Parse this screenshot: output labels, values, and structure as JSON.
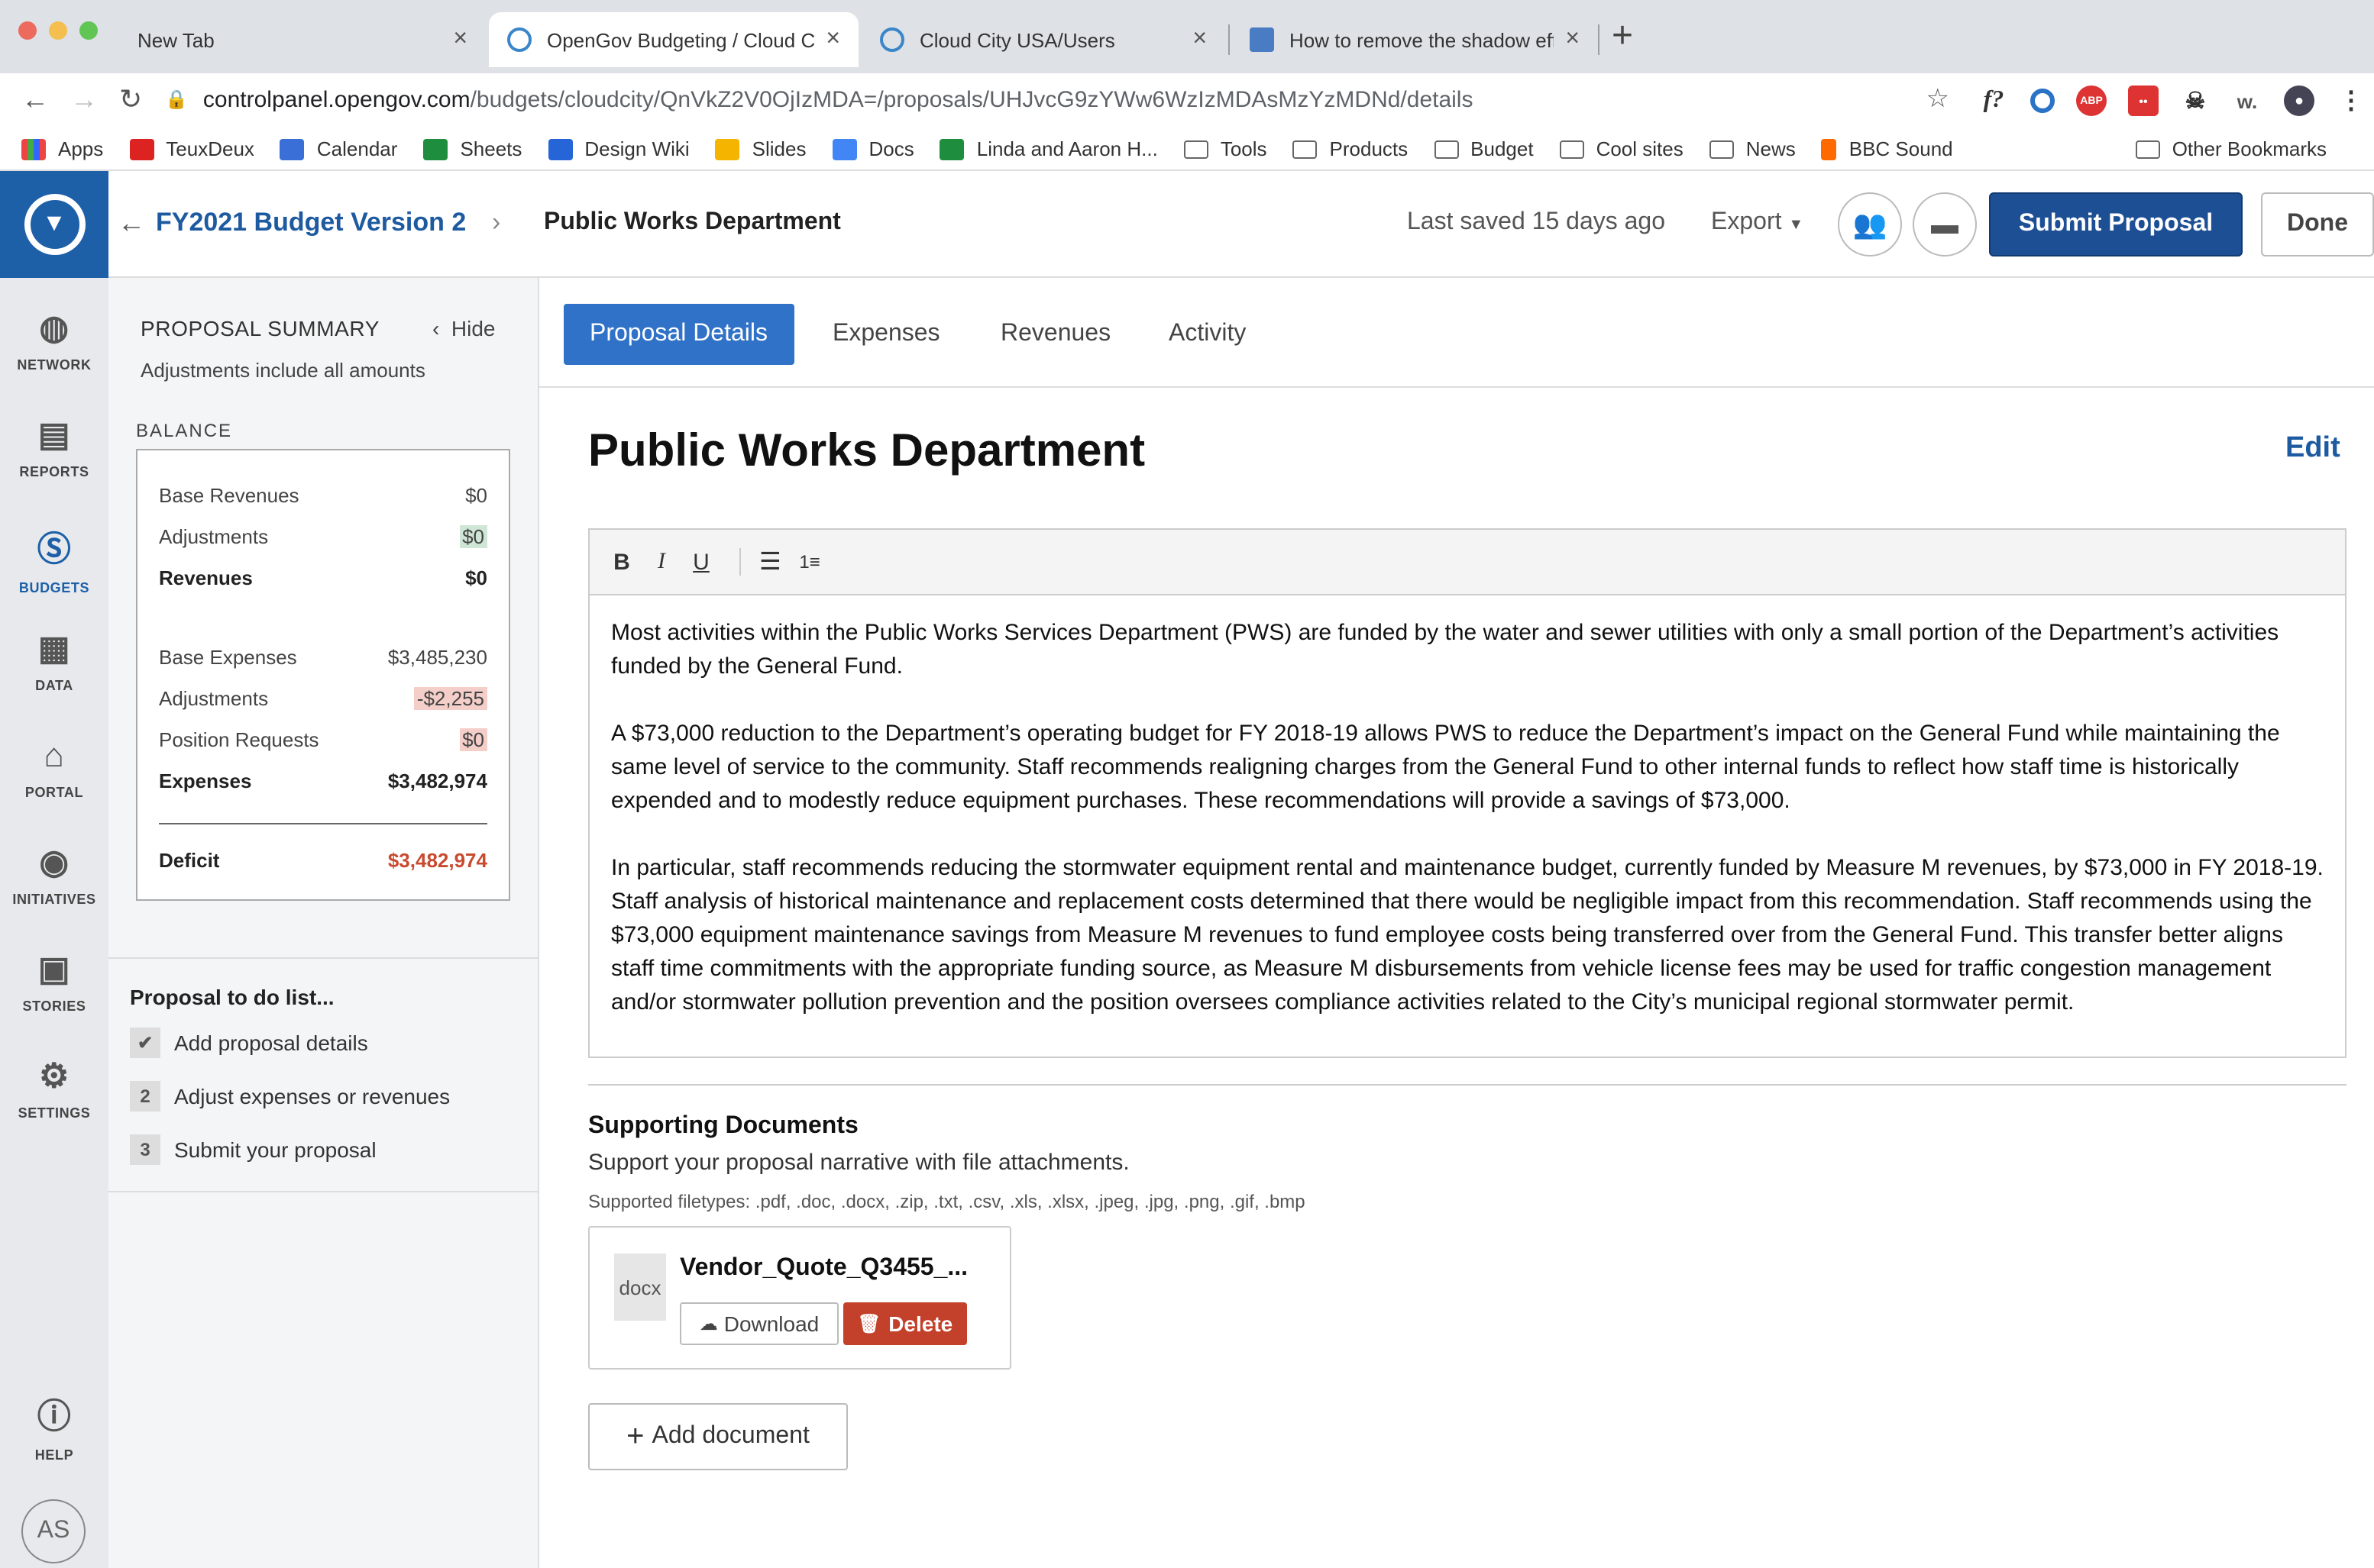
{
  "browser": {
    "tabs": [
      {
        "title": "New Tab"
      },
      {
        "title": "OpenGov Budgeting / Cloud Ci"
      },
      {
        "title": "Cloud City USA/Users"
      },
      {
        "title": "How to remove the shadow eff"
      }
    ],
    "url_host": "controlpanel.opengov.com",
    "url_path": "/budgets/cloudcity/QnVkZ2V0OjIzMDA=/proposals/UHJvcG9zYWw6WzIzMDAsMzYzMDNd/details",
    "bookmarks": [
      "Apps",
      "TeuxDeux",
      "Calendar",
      "Sheets",
      "Design Wiki",
      "Slides",
      "Docs",
      "Linda and Aaron H...",
      "Tools",
      "Products",
      "Budget",
      "Cool sites",
      "News",
      "BBC Sound"
    ],
    "other_bookmarks": "Other Bookmarks"
  },
  "rail": {
    "items": [
      {
        "label": "NETWORK",
        "icon": "globe-icon"
      },
      {
        "label": "REPORTS",
        "icon": "reports-icon"
      },
      {
        "label": "BUDGETS",
        "icon": "dollar-icon",
        "active": true
      },
      {
        "label": "DATA",
        "icon": "data-icon"
      },
      {
        "label": "PORTAL",
        "icon": "portal-icon"
      },
      {
        "label": "INITIATIVES",
        "icon": "initiatives-icon"
      },
      {
        "label": "STORIES",
        "icon": "stories-icon"
      },
      {
        "label": "SETTINGS",
        "icon": "gear-icon"
      },
      {
        "label": "HELP",
        "icon": "help-icon"
      }
    ],
    "avatar": "AS"
  },
  "header": {
    "budget_link": "FY2021 Budget Version 2",
    "current": "Public Works Department",
    "saved": "Last saved 15 days ago",
    "export": "Export",
    "submit": "Submit Proposal",
    "done": "Done"
  },
  "sidebar": {
    "title": "PROPOSAL SUMMARY",
    "hide": "Hide",
    "subtitle": "Adjustments include all amounts",
    "balance_label": "BALANCE",
    "rows": {
      "base_revenues": {
        "label": "Base Revenues",
        "value": "$0"
      },
      "rev_adjustments": {
        "label": "Adjustments",
        "value": "$0"
      },
      "revenues": {
        "label": "Revenues",
        "value": "$0"
      },
      "base_expenses": {
        "label": "Base Expenses",
        "value": "$3,485,230"
      },
      "exp_adjustments": {
        "label": "Adjustments",
        "value": "-$2,255"
      },
      "position_requests": {
        "label": "Position Requests",
        "value": "$0"
      },
      "expenses": {
        "label": "Expenses",
        "value": "$3,482,974"
      },
      "deficit": {
        "label": "Deficit",
        "value": "$3,482,974"
      }
    },
    "todo_title": "Proposal to do list...",
    "todos": [
      {
        "num": "✔",
        "label": "Add proposal details"
      },
      {
        "num": "2",
        "label": "Adjust expenses or revenues"
      },
      {
        "num": "3",
        "label": "Submit your proposal"
      }
    ]
  },
  "main": {
    "tabs": [
      "Proposal Details",
      "Expenses",
      "Revenues",
      "Activity"
    ],
    "title": "Public Works Department",
    "edit": "Edit",
    "paragraphs": [
      "Most activities within the Public Works Services Department (PWS) are funded by the water and sewer utilities with only a small portion of the Department’s activities funded by the General Fund.",
      "A $73,000 reduction to the Department’s operating budget for FY 2018-19 allows PWS to reduce the Department’s impact on the General Fund while maintaining the same level of service to the community.   Staff recommends realigning charges from the General Fund to other internal funds to reflect how staff time is historically expended and to modestly reduce equipment purchases. These recommendations will provide a savings of $73,000.",
      "In particular, staff recommends reducing the stormwater equipment rental and maintenance budget, currently funded by Measure M revenues, by $73,000 in FY 2018-19. Staff analysis of historical maintenance and replacement costs determined that there would be negligible impact from this recommendation. Staff recommends using the $73,000 equipment maintenance savings from Measure M revenues to fund employee costs being transferred over from the General Fund. This transfer better aligns staff time commitments with the appropriate funding source, as Measure M disbursements from vehicle license fees may be used for traffic congestion management and/or stormwater pollution prevention and the position oversees compliance activities related to the City’s municipal regional stormwater permit."
    ],
    "supporting": {
      "title": "Supporting Documents",
      "subtitle": "Support your proposal narrative with file attachments.",
      "filetypes": "Supported filetypes: .pdf, .doc, .docx, .zip, .txt, .csv, .xls, .xlsx, .jpeg, .jpg, .png, .gif, .bmp",
      "doc": {
        "ext": "docx",
        "name": "Vendor_Quote_Q3455_...",
        "download": "Download",
        "delete": "Delete"
      },
      "add": "Add document"
    }
  }
}
